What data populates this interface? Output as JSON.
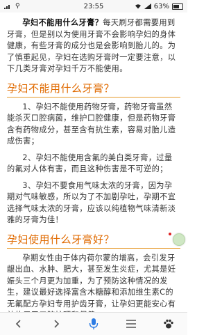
{
  "status": {
    "time": "23:55",
    "battery_percent": "63%"
  },
  "article": {
    "intro_bold": "孕妇不能用什么牙膏？",
    "intro_rest": "每天刷牙都需要用到牙膏，但是别以为使用牙膏不会影响孕妇的身体健康，有些牙膏的成分也是会影响到胎儿的。为了慎重起见，孕妇在选购牙膏时一定要注意，以下几类牙膏对孕妇千万不能使用。",
    "heading1": "孕妇不能用什么牙膏？",
    "p1": "1、孕妇不能使用药物牙膏，药物牙膏虽然能杀灭口腔病菌，维护口腔健康，但是药物牙膏含有药物成分，甚至含有抗生素，容易对胎儿造成伤害；",
    "p2": "2、孕妇不能使用含氟的美白类牙膏，过量的氟对人体有害，而且这种伤害是不可逆的；",
    "p3": "3、孕妇不要食用气味太浓的牙膏，因为孕期对气味敏感，所以为了不加剧孕吐，孕期不宜选择气味太浓的牙膏，应该以纯植物气味清新淡雅的牙膏为佳！",
    "heading2": "孕妇使用什么牙膏好？",
    "p4": "孕期女性由于体内荷尔蒙的增高，会引发牙龈出血、水肿、肥大，甚至发生炎症，尤其是妊娠头三个月更为加重，为了预防这种情况的发生，建议最好选择富含木糖醇和添加维生素C的无氟配方孕妇专用护齿牙膏，让孕妇更能安心有效的用于口腔护理和保健。"
  },
  "icons": {
    "back": "back-arrow-icon",
    "forward": "forward-arrow-icon",
    "voice": "microphone-icon",
    "menu": "menu-icon",
    "paw": "paw-icon"
  },
  "colors": {
    "heading": "#e06a00",
    "heading_rule": "#e69a2a",
    "voice_accent": "#2b7be4"
  }
}
